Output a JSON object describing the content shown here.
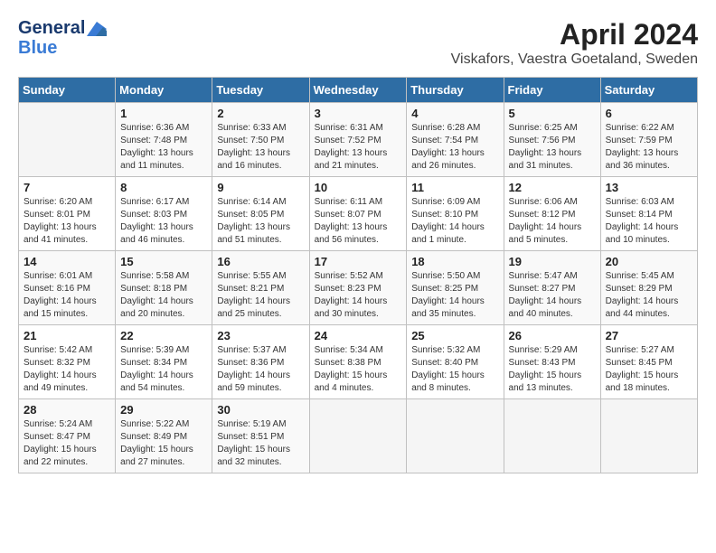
{
  "header": {
    "logo_line1": "General",
    "logo_line2": "Blue",
    "month": "April 2024",
    "location": "Viskafors, Vaestra Goetaland, Sweden"
  },
  "weekdays": [
    "Sunday",
    "Monday",
    "Tuesday",
    "Wednesday",
    "Thursday",
    "Friday",
    "Saturday"
  ],
  "weeks": [
    [
      {
        "day": "",
        "sunrise": "",
        "sunset": "",
        "daylight": ""
      },
      {
        "day": "1",
        "sunrise": "Sunrise: 6:36 AM",
        "sunset": "Sunset: 7:48 PM",
        "daylight": "Daylight: 13 hours and 11 minutes."
      },
      {
        "day": "2",
        "sunrise": "Sunrise: 6:33 AM",
        "sunset": "Sunset: 7:50 PM",
        "daylight": "Daylight: 13 hours and 16 minutes."
      },
      {
        "day": "3",
        "sunrise": "Sunrise: 6:31 AM",
        "sunset": "Sunset: 7:52 PM",
        "daylight": "Daylight: 13 hours and 21 minutes."
      },
      {
        "day": "4",
        "sunrise": "Sunrise: 6:28 AM",
        "sunset": "Sunset: 7:54 PM",
        "daylight": "Daylight: 13 hours and 26 minutes."
      },
      {
        "day": "5",
        "sunrise": "Sunrise: 6:25 AM",
        "sunset": "Sunset: 7:56 PM",
        "daylight": "Daylight: 13 hours and 31 minutes."
      },
      {
        "day": "6",
        "sunrise": "Sunrise: 6:22 AM",
        "sunset": "Sunset: 7:59 PM",
        "daylight": "Daylight: 13 hours and 36 minutes."
      }
    ],
    [
      {
        "day": "7",
        "sunrise": "Sunrise: 6:20 AM",
        "sunset": "Sunset: 8:01 PM",
        "daylight": "Daylight: 13 hours and 41 minutes."
      },
      {
        "day": "8",
        "sunrise": "Sunrise: 6:17 AM",
        "sunset": "Sunset: 8:03 PM",
        "daylight": "Daylight: 13 hours and 46 minutes."
      },
      {
        "day": "9",
        "sunrise": "Sunrise: 6:14 AM",
        "sunset": "Sunset: 8:05 PM",
        "daylight": "Daylight: 13 hours and 51 minutes."
      },
      {
        "day": "10",
        "sunrise": "Sunrise: 6:11 AM",
        "sunset": "Sunset: 8:07 PM",
        "daylight": "Daylight: 13 hours and 56 minutes."
      },
      {
        "day": "11",
        "sunrise": "Sunrise: 6:09 AM",
        "sunset": "Sunset: 8:10 PM",
        "daylight": "Daylight: 14 hours and 1 minute."
      },
      {
        "day": "12",
        "sunrise": "Sunrise: 6:06 AM",
        "sunset": "Sunset: 8:12 PM",
        "daylight": "Daylight: 14 hours and 5 minutes."
      },
      {
        "day": "13",
        "sunrise": "Sunrise: 6:03 AM",
        "sunset": "Sunset: 8:14 PM",
        "daylight": "Daylight: 14 hours and 10 minutes."
      }
    ],
    [
      {
        "day": "14",
        "sunrise": "Sunrise: 6:01 AM",
        "sunset": "Sunset: 8:16 PM",
        "daylight": "Daylight: 14 hours and 15 minutes."
      },
      {
        "day": "15",
        "sunrise": "Sunrise: 5:58 AM",
        "sunset": "Sunset: 8:18 PM",
        "daylight": "Daylight: 14 hours and 20 minutes."
      },
      {
        "day": "16",
        "sunrise": "Sunrise: 5:55 AM",
        "sunset": "Sunset: 8:21 PM",
        "daylight": "Daylight: 14 hours and 25 minutes."
      },
      {
        "day": "17",
        "sunrise": "Sunrise: 5:52 AM",
        "sunset": "Sunset: 8:23 PM",
        "daylight": "Daylight: 14 hours and 30 minutes."
      },
      {
        "day": "18",
        "sunrise": "Sunrise: 5:50 AM",
        "sunset": "Sunset: 8:25 PM",
        "daylight": "Daylight: 14 hours and 35 minutes."
      },
      {
        "day": "19",
        "sunrise": "Sunrise: 5:47 AM",
        "sunset": "Sunset: 8:27 PM",
        "daylight": "Daylight: 14 hours and 40 minutes."
      },
      {
        "day": "20",
        "sunrise": "Sunrise: 5:45 AM",
        "sunset": "Sunset: 8:29 PM",
        "daylight": "Daylight: 14 hours and 44 minutes."
      }
    ],
    [
      {
        "day": "21",
        "sunrise": "Sunrise: 5:42 AM",
        "sunset": "Sunset: 8:32 PM",
        "daylight": "Daylight: 14 hours and 49 minutes."
      },
      {
        "day": "22",
        "sunrise": "Sunrise: 5:39 AM",
        "sunset": "Sunset: 8:34 PM",
        "daylight": "Daylight: 14 hours and 54 minutes."
      },
      {
        "day": "23",
        "sunrise": "Sunrise: 5:37 AM",
        "sunset": "Sunset: 8:36 PM",
        "daylight": "Daylight: 14 hours and 59 minutes."
      },
      {
        "day": "24",
        "sunrise": "Sunrise: 5:34 AM",
        "sunset": "Sunset: 8:38 PM",
        "daylight": "Daylight: 15 hours and 4 minutes."
      },
      {
        "day": "25",
        "sunrise": "Sunrise: 5:32 AM",
        "sunset": "Sunset: 8:40 PM",
        "daylight": "Daylight: 15 hours and 8 minutes."
      },
      {
        "day": "26",
        "sunrise": "Sunrise: 5:29 AM",
        "sunset": "Sunset: 8:43 PM",
        "daylight": "Daylight: 15 hours and 13 minutes."
      },
      {
        "day": "27",
        "sunrise": "Sunrise: 5:27 AM",
        "sunset": "Sunset: 8:45 PM",
        "daylight": "Daylight: 15 hours and 18 minutes."
      }
    ],
    [
      {
        "day": "28",
        "sunrise": "Sunrise: 5:24 AM",
        "sunset": "Sunset: 8:47 PM",
        "daylight": "Daylight: 15 hours and 22 minutes."
      },
      {
        "day": "29",
        "sunrise": "Sunrise: 5:22 AM",
        "sunset": "Sunset: 8:49 PM",
        "daylight": "Daylight: 15 hours and 27 minutes."
      },
      {
        "day": "30",
        "sunrise": "Sunrise: 5:19 AM",
        "sunset": "Sunset: 8:51 PM",
        "daylight": "Daylight: 15 hours and 32 minutes."
      },
      {
        "day": "",
        "sunrise": "",
        "sunset": "",
        "daylight": ""
      },
      {
        "day": "",
        "sunrise": "",
        "sunset": "",
        "daylight": ""
      },
      {
        "day": "",
        "sunrise": "",
        "sunset": "",
        "daylight": ""
      },
      {
        "day": "",
        "sunrise": "",
        "sunset": "",
        "daylight": ""
      }
    ]
  ]
}
